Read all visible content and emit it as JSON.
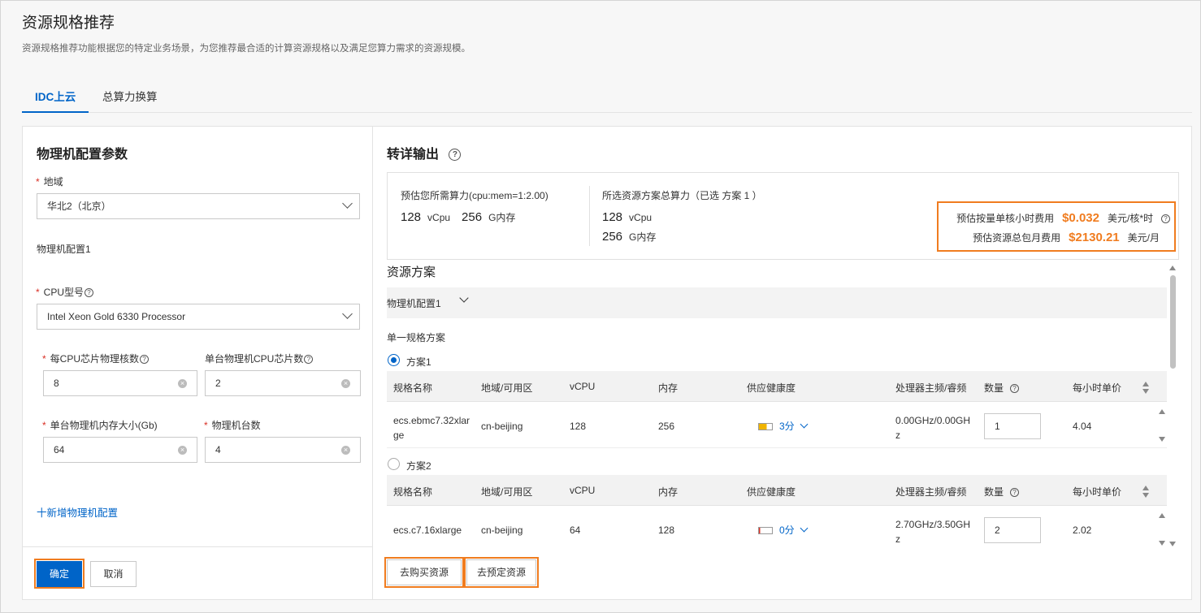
{
  "page": {
    "title": "资源规格推荐",
    "description": "资源规格推荐功能根据您的特定业务场景，为您推荐最合适的计算资源规格以及满足您算力需求的资源规模。"
  },
  "tabs": [
    {
      "label": "IDC上云",
      "active": true
    },
    {
      "label": "总算力换算",
      "active": false
    }
  ],
  "left": {
    "title": "物理机配置参数",
    "region_label": "地域",
    "region_value": "华北2（北京）",
    "config_group": "物理机配置1",
    "cpu_model_label": "CPU型号",
    "cpu_model_value": "Intel Xeon Gold 6330 Processor",
    "cores_label": "每CPU芯片物理核数",
    "cores_value": "8",
    "chips_label": "单台物理机CPU芯片数",
    "chips_value": "2",
    "memory_label": "单台物理机内存大小(Gb)",
    "memory_value": "64",
    "count_label": "物理机台数",
    "count_value": "4",
    "add_link": "十新增物理机配置",
    "confirm": "确定",
    "cancel": "取消"
  },
  "right": {
    "title": "转详输出",
    "summary": {
      "need_title": "预估您所需算力(cpu:mem=1:2.00)",
      "need_vcpu": "128",
      "need_vcpu_unit": "vCpu",
      "need_mem": "256",
      "need_mem_unit": "G内存",
      "selected_title": "所选资源方案总算力（已选 方案 1 ）",
      "sel_vcpu": "128",
      "sel_vcpu_unit": "vCpu",
      "sel_mem": "256",
      "sel_mem_unit": "G内存",
      "hourly_label": "预估按量单核小时费用",
      "hourly_price": "$0.032",
      "hourly_unit": "美元/核*时",
      "monthly_label": "预估资源总包月费用",
      "monthly_price": "$2130.21",
      "monthly_unit": "美元/月"
    },
    "resource_title": "资源方案",
    "group_label": "物理机配置1",
    "single_spec": "单一规格方案",
    "columns": [
      "规格名称",
      "地域/可用区",
      "vCPU",
      "内存",
      "供应健康度",
      "处理器主频/睿频",
      "数量",
      "每小时单价"
    ],
    "plans": [
      {
        "name": "方案1",
        "selected": true,
        "spec": "ecs.ebmc7.32xlarge",
        "spec_line1": "ecs.ebmc7.32xlar",
        "spec_line2": "ge",
        "region": "cn-beijing",
        "vcpu": "128",
        "memory": "256",
        "health": "3分",
        "freq_line1": "0.00GHz/0.00GH",
        "freq_line2": "z",
        "qty": "1",
        "price": "4.04"
      },
      {
        "name": "方案2",
        "selected": false,
        "spec": "ecs.c7.16xlarge",
        "region": "cn-beijing",
        "vcpu": "64",
        "memory": "128",
        "health": "0分",
        "freq_line1": "2.70GHz/3.50GH",
        "freq_line2": "z",
        "qty": "2",
        "price": "2.02"
      }
    ],
    "buy_button": "去购买资源",
    "reserve_button": "去预定资源"
  }
}
